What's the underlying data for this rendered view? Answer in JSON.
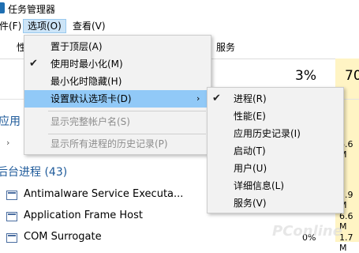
{
  "window": {
    "title": "任务管理器"
  },
  "menubar": {
    "file": "件(F)",
    "options": "选项(O)",
    "view": "查看(V)"
  },
  "tabs": {
    "partial_left": "性",
    "services": "服务"
  },
  "columns": {
    "cpu_percent": "3%",
    "mem_percent": "70"
  },
  "groups": {
    "apps_partial": "应用",
    "background": "后台进程 (43)"
  },
  "processes": [
    {
      "name": "Antimalware Service Executa...",
      "mem": "7.9 M"
    },
    {
      "name": "Application Frame Host",
      "mem": "6.6 M"
    },
    {
      "name": "COM Surrogate",
      "cpu": "0%",
      "mem": "1.7 M"
    }
  ],
  "apps_row_mem": "6.6 M",
  "options_menu": {
    "items": [
      {
        "label": "置于顶层(A)",
        "checked": false,
        "disabled": false
      },
      {
        "label": "使用时最小化(M)",
        "checked": true,
        "disabled": false
      },
      {
        "label": "最小化时隐藏(H)",
        "checked": false,
        "disabled": false
      },
      {
        "label": "设置默认选项卡(D)",
        "checked": false,
        "disabled": false,
        "submenu": true
      },
      {
        "label": "显示完整帐户名(S)",
        "checked": false,
        "disabled": true
      },
      {
        "label": "显示所有进程的历史记录(P)",
        "checked": false,
        "disabled": true
      }
    ]
  },
  "tab_submenu": {
    "items": [
      {
        "label": "进程(R)",
        "checked": true
      },
      {
        "label": "性能(E)",
        "checked": false
      },
      {
        "label": "应用历史记录(I)",
        "checked": false
      },
      {
        "label": "启动(T)",
        "checked": false
      },
      {
        "label": "用户(U)",
        "checked": false
      },
      {
        "label": "详细信息(L)",
        "checked": false
      },
      {
        "label": "服务(V)",
        "checked": false
      }
    ]
  },
  "watermark": "PConline"
}
